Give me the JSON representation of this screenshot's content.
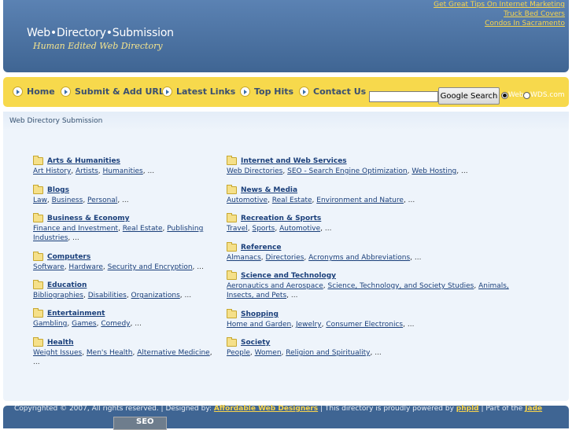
{
  "header": {
    "logo_title": "Web•Directory•Submission",
    "logo_subtitle": "Human Edited Web Directory",
    "top_links": [
      "Get Great Tips On Internet Marketing",
      "Truck Bed Covers",
      "Condos In Sacramento"
    ]
  },
  "nav": {
    "items": [
      "Home",
      "Submit & Add URL",
      "Latest Links",
      "Top Hits",
      "Contact Us"
    ],
    "search_button": "Google Search",
    "radio_web": "Web",
    "radio_site": "WDS.com"
  },
  "breadcrumb": "Web Directory Submission",
  "categories_left": [
    {
      "name": "Arts & Humanities",
      "subs": [
        "Art History",
        "Artists",
        "Humanities"
      ]
    },
    {
      "name": "Blogs",
      "subs": [
        "Law",
        "Business",
        "Personal"
      ]
    },
    {
      "name": "Business & Economy",
      "subs": [
        "Finance and Investment",
        "Real Estate",
        "Publishing Industries"
      ]
    },
    {
      "name": "Computers",
      "subs": [
        "Software",
        "Hardware",
        "Security and Encryption"
      ]
    },
    {
      "name": "Education",
      "subs": [
        "Bibliographies",
        "Disabilities",
        "Organizations"
      ]
    },
    {
      "name": "Entertainment",
      "subs": [
        "Gambling",
        "Games",
        "Comedy"
      ]
    },
    {
      "name": "Health",
      "subs": [
        "Weight Issues",
        "Men's Health",
        "Alternative Medicine"
      ]
    }
  ],
  "categories_right": [
    {
      "name": "Internet and Web Services",
      "subs": [
        "Web Directories",
        "SEO - Search Engine Optimization",
        "Web Hosting"
      ]
    },
    {
      "name": "News & Media",
      "subs": [
        "Automotive",
        "Real Estate",
        "Environment and Nature"
      ]
    },
    {
      "name": "Recreation & Sports",
      "subs": [
        "Travel",
        "Sports",
        "Automotive"
      ]
    },
    {
      "name": "Reference",
      "subs": [
        "Almanacs",
        "Directories",
        "Acronyms and Abbreviations"
      ]
    },
    {
      "name": "Science and Technology",
      "subs": [
        "Aeronautics and Aerospace",
        "Science, Technology, and Society Studies",
        "Animals, Insects, and Pets"
      ]
    },
    {
      "name": "Shopping",
      "subs": [
        "Home and Garden",
        "Jewelry",
        "Consumer Electronics"
      ]
    },
    {
      "name": "Society",
      "subs": [
        "People",
        "Women",
        "Religion and Spirituality"
      ]
    }
  ],
  "more": "...",
  "footer": {
    "text1": "Copyrighted © 2007, All rights reserved. | Designed by: ",
    "link1": "Affordable Web Designers",
    "text2": " | This directory is proudly powered by ",
    "link2": "phpld",
    "text3": " | Part of the ",
    "link3": "Jade",
    "badge": "SEO"
  }
}
